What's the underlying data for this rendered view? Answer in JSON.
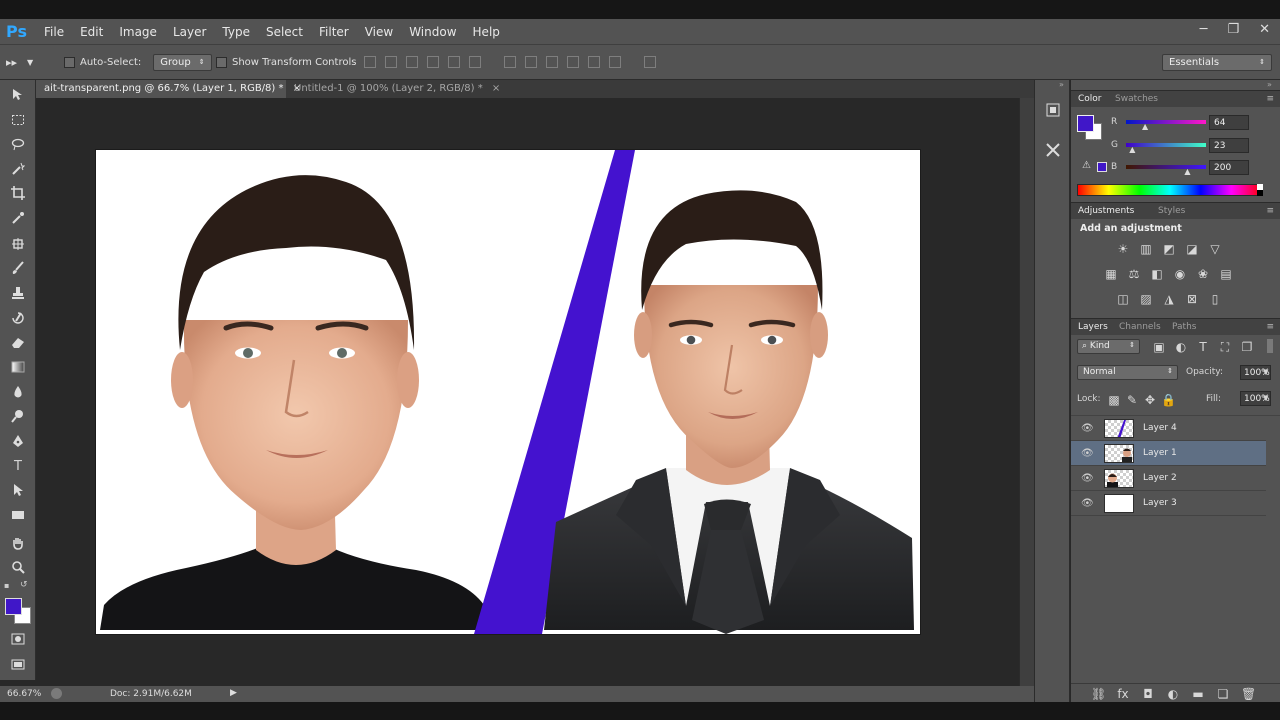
{
  "app": {
    "logo": "Ps",
    "menu": [
      "File",
      "Edit",
      "Image",
      "Layer",
      "Type",
      "Select",
      "Filter",
      "View",
      "Window",
      "Help"
    ],
    "window_controls": [
      "─",
      "❐",
      "✕"
    ]
  },
  "options_bar": {
    "auto_select_label": "Auto-Select:",
    "auto_select_value": "Group",
    "show_transform_label": "Show Transform Controls",
    "workspace": "Essentials"
  },
  "tabs": [
    {
      "label": "ait-transparent.png @ 66.7% (Layer 1, RGB/8) *",
      "close": "×"
    },
    {
      "label": "Untitled-1 @ 100% (Layer 2, RGB/8) *",
      "close": "×"
    }
  ],
  "status": {
    "zoom": "66.67%",
    "doc": "Doc: 2.91M/6.62M"
  },
  "colors": {
    "foreground": "#4017c8",
    "background": "#ffffff",
    "accent_stripe": "#4412cf"
  },
  "color_panel": {
    "tabs": [
      "Color",
      "Swatches"
    ],
    "r_label": "R",
    "r_value": "64",
    "g_label": "G",
    "g_value": "23",
    "b_label": "B",
    "b_value": "200",
    "r_level": 0.25,
    "g_level": 0.09,
    "b_level": 0.78
  },
  "adjustments_panel": {
    "tabs": [
      "Adjustments",
      "Styles"
    ],
    "heading": "Add an adjustment",
    "icons": [
      [
        "brightness-icon",
        "levels-icon",
        "curves-icon",
        "exposure-icon",
        "vibrance-icon"
      ],
      [
        "hue-saturation-icon",
        "color-balance-icon",
        "black-white-icon",
        "photo-filter-icon",
        "channel-mixer-icon",
        "color-lookup-icon"
      ],
      [
        "invert-icon",
        "posterize-icon",
        "threshold-icon",
        "selective-color-icon",
        "gradient-map-icon"
      ]
    ]
  },
  "layers_panel": {
    "tabs": [
      "Layers",
      "Channels",
      "Paths"
    ],
    "kind_label": "Kind",
    "blend_mode": "Normal",
    "opacity_label": "Opacity:",
    "opacity_value": "100%",
    "lock_label": "Lock:",
    "fill_label": "Fill:",
    "fill_value": "100%",
    "layers": [
      {
        "name": "Layer 4",
        "selected": false
      },
      {
        "name": "Layer 1",
        "selected": true
      },
      {
        "name": "Layer 2",
        "selected": false
      },
      {
        "name": "Layer 3",
        "selected": false
      }
    ]
  }
}
